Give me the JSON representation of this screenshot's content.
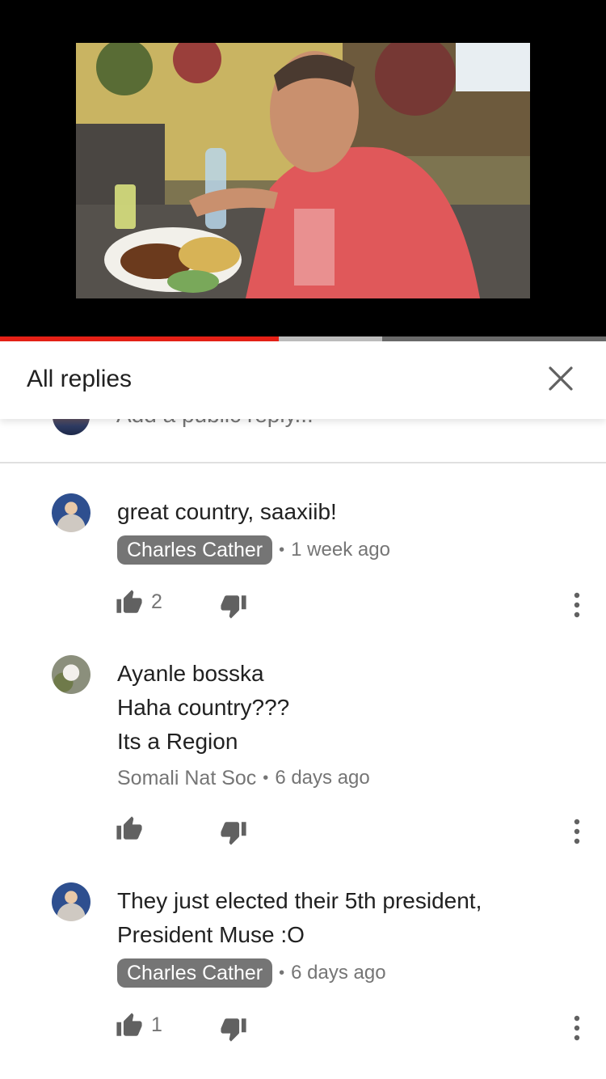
{
  "header": {
    "title": "All replies",
    "close_icon": "close-icon"
  },
  "progress": {
    "played_fraction": 0.46,
    "buffered_fraction": 0.63
  },
  "add_reply": {
    "placeholder": "Add a public reply..."
  },
  "comments": [
    {
      "lines": [
        "great country, saaxiib!"
      ],
      "author": "Charles Cather",
      "author_style": "chip",
      "time": "1 week ago",
      "likes": "2"
    },
    {
      "lines": [
        "Ayanle bosska",
        "Haha country???",
        "Its a Region"
      ],
      "author": "Somali Nat Soc",
      "author_style": "plain",
      "time": "6 days ago",
      "likes": ""
    },
    {
      "lines": [
        "They just elected their 5th president,",
        "President Muse :O"
      ],
      "author": "Charles Cather",
      "author_style": "chip",
      "time": "6 days ago",
      "likes": "1"
    }
  ],
  "colors": {
    "progress_played": "#e62117",
    "chip_bg": "#757575",
    "meta_text": "#757575"
  }
}
